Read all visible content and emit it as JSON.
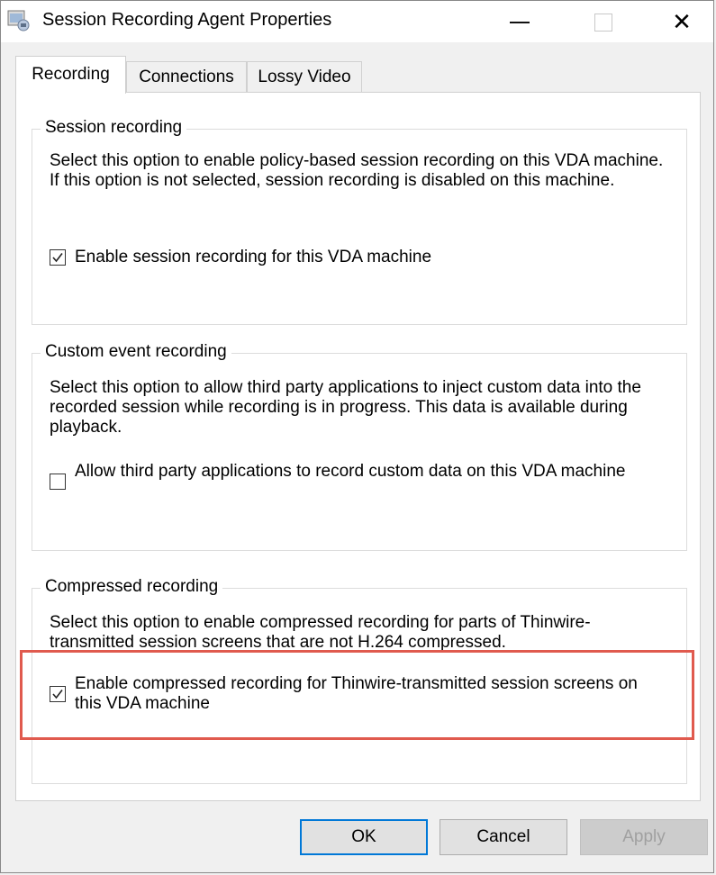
{
  "window": {
    "title": "Session Recording Agent Properties",
    "minimize_glyph": "—",
    "close_glyph": "✕"
  },
  "tabs": [
    {
      "label": "Recording",
      "active": true
    },
    {
      "label": "Connections",
      "active": false
    },
    {
      "label": "Lossy Video",
      "active": false
    }
  ],
  "groups": {
    "session_recording": {
      "legend": "Session recording",
      "description": "Select this option to enable policy-based session recording on this VDA machine. If this option is not selected, session recording is disabled on this machine.",
      "checkbox_label": "Enable session recording for this VDA machine",
      "checked": true
    },
    "custom_event": {
      "legend": "Custom event recording",
      "description": "Select this option to allow third party applications to inject custom data into the recorded session while recording is in progress. This data is available during playback.",
      "checkbox_label": "Allow third party applications to record custom data on this VDA machine",
      "checked": false
    },
    "compressed": {
      "legend": "Compressed recording",
      "description": "Select this option to enable compressed recording for parts of Thinwire-transmitted session screens that are not H.264 compressed.",
      "checkbox_label": "Enable compressed recording for Thinwire-transmitted session screens on this VDA machine",
      "checked": true
    }
  },
  "buttons": {
    "ok": "OK",
    "cancel": "Cancel",
    "apply": "Apply"
  },
  "colors": {
    "highlight": "#e05a4e",
    "default_button_border": "#0078d7"
  }
}
